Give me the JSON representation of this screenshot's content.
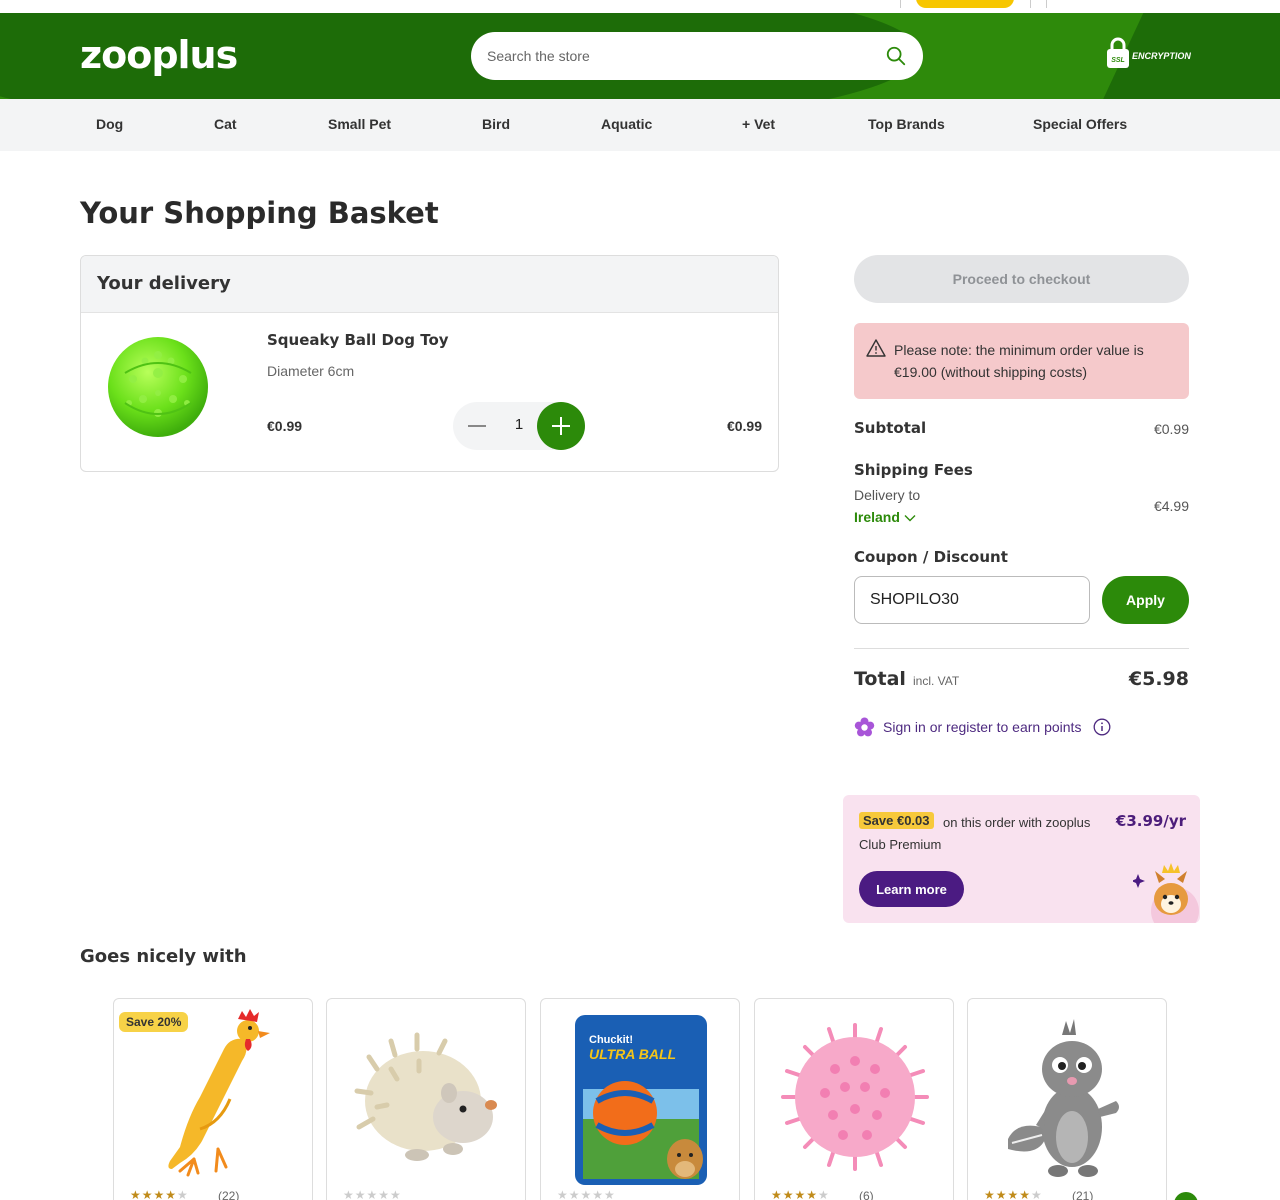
{
  "header": {
    "logo": "zooplus",
    "search_placeholder": "Search the store",
    "ssl_badge": "SSL",
    "ssl_label": "ENCRYPTION"
  },
  "nav": [
    "Dog",
    "Cat",
    "Small Pet",
    "Bird",
    "Aquatic",
    "+ Vet",
    "Top Brands",
    "Special Offers"
  ],
  "page_title": "Your Shopping Basket",
  "delivery": {
    "title": "Your delivery",
    "item": {
      "name": "Squeaky Ball Dog Toy",
      "variant": "Diameter 6cm",
      "unit_price": "€0.99",
      "quantity": "1",
      "line_total": "€0.99"
    }
  },
  "summary": {
    "checkout_label": "Proceed to checkout",
    "notice": "Please note: the minimum order value is €19.00 (without shipping costs)",
    "subtotal_label": "Subtotal",
    "subtotal_value": "€0.99",
    "shipping_label": "Shipping Fees",
    "delivery_to": "Delivery to",
    "country": "Ireland",
    "shipping_value": "€4.99",
    "coupon_label": "Coupon / Discount",
    "coupon_value": "SHOPILO30",
    "apply_label": "Apply",
    "total_label": "Total",
    "total_vat": "incl. VAT",
    "total_value": "€5.98",
    "points_text": "Sign in or register to earn points"
  },
  "premium": {
    "save_badge": "Save €0.03",
    "message": "on this order with zooplus Club Premium",
    "price": "€3.99/yr",
    "learn_more": "Learn more"
  },
  "recommendations": {
    "title": "Goes nicely with",
    "items": [
      {
        "badge": "Save 20%",
        "rating": 4,
        "count": "(22)",
        "image": "rubber-chicken"
      },
      {
        "badge": "",
        "rating": 0,
        "count": "",
        "image": "hedgehog-plush"
      },
      {
        "badge": "",
        "rating": 0,
        "count": "",
        "image": "chuckit-ultra-ball"
      },
      {
        "badge": "",
        "rating": 4,
        "count": "(6)",
        "image": "pink-spiky-ball"
      },
      {
        "badge": "",
        "rating": 4,
        "count": "(21)",
        "image": "squirrel-plush"
      }
    ]
  },
  "colors": {
    "brand_green": "#2c8a0a",
    "premium_purple": "#4b1b82",
    "notice_bg": "#f5c9cb"
  }
}
